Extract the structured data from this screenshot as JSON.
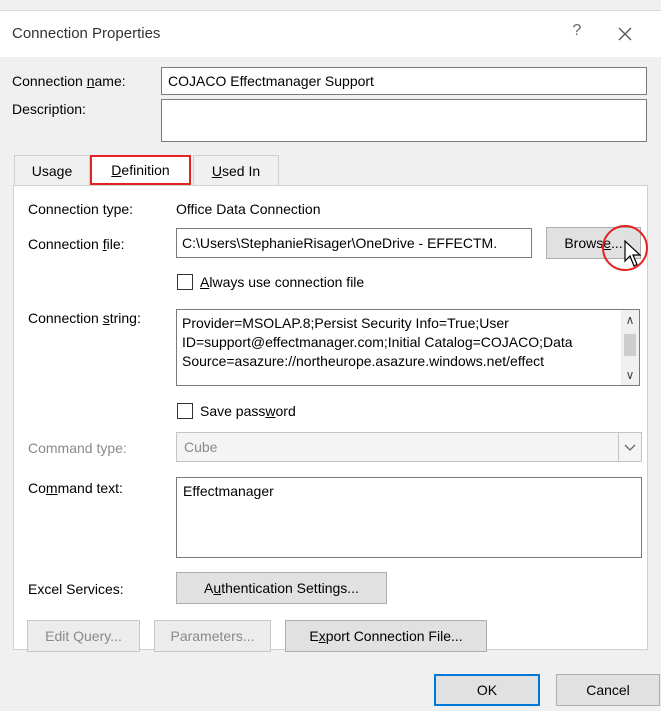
{
  "window": {
    "title": "Connection Properties",
    "help_glyph": "?",
    "close_icon": "close-icon"
  },
  "connection_name": {
    "label_pre": "Connection ",
    "label_u": "n",
    "label_post": "ame:",
    "value": "COJACO Effectmanager Support"
  },
  "description": {
    "label": "Description:",
    "value": ""
  },
  "tabs": [
    {
      "pre": "Usa",
      "u": "g",
      "post": "e",
      "active": false
    },
    {
      "pre": "",
      "u": "D",
      "post": "efinition",
      "active": true
    },
    {
      "pre": "",
      "u": "U",
      "post": "sed In",
      "active": false
    }
  ],
  "definition": {
    "connection_type_label": "Connection type:",
    "connection_type_value": "Office Data Connection",
    "connection_file_label_pre": "Connection ",
    "connection_file_label_u": "f",
    "connection_file_label_post": "ile:",
    "connection_file_value": "C:\\Users\\StephanieRisager\\OneDrive - EFFECTM.",
    "browse_pre": "Brows",
    "browse_u": "e",
    "browse_post": "...",
    "always_use_pre": "",
    "always_use_u": "A",
    "always_use_post": "lways use connection file",
    "always_use_checked": false,
    "connection_string_label_pre": "Connection ",
    "connection_string_label_u": "s",
    "connection_string_label_post": "tring:",
    "connection_string_value": "Provider=MSOLAP.8;Persist Security Info=True;User ID=support@effectmanager.com;Initial Catalog=COJACO;Data Source=asazure://northeurope.asazure.windows.net/effect",
    "save_password_pre": "Save pass",
    "save_password_u": "w",
    "save_password_post": "ord",
    "save_password_checked": false,
    "command_type_label": "Command type:",
    "command_type_value": "Cube",
    "command_text_label_pre": "Co",
    "command_text_label_u": "m",
    "command_text_label_post": "mand text:",
    "command_text_value": "Effectmanager",
    "excel_services_label": "Excel Services:",
    "auth_settings_pre": "A",
    "auth_settings_u": "u",
    "auth_settings_post": "thentication Settings...",
    "edit_query": "Edit Query...",
    "parameters": "Parameters...",
    "export_pre": "E",
    "export_u": "x",
    "export_post": "port Connection File..."
  },
  "footer": {
    "ok": "OK",
    "cancel": "Cancel"
  },
  "colors": {
    "highlight": "#e52222",
    "default_button_border": "#0078d7"
  }
}
